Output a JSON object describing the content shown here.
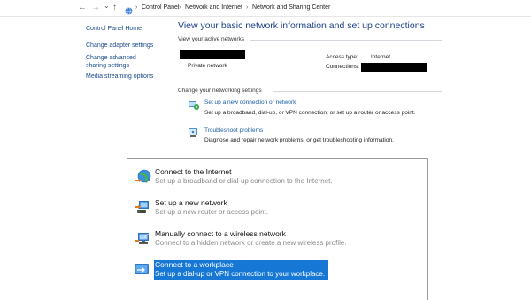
{
  "address": {
    "crumbs": [
      "Control Panel",
      "Network and Internet",
      "Network and Sharing Center"
    ],
    "sep": "›",
    "back": "←",
    "forward": "→",
    "dropdown": "⌄",
    "up": "↑"
  },
  "left_pane": {
    "home": "Control Panel Home",
    "links": [
      "Change adapter settings",
      "Change advanced sharing settings",
      "Media streaming options"
    ]
  },
  "main": {
    "title": "View your basic network information and set up connections",
    "active_header": "View your active networks",
    "network_type": "Private network",
    "access_type_label": "Access type:",
    "access_type_value": "Internet",
    "connections_label": "Connections:",
    "change_header": "Change your networking settings",
    "actions": [
      {
        "link": "Set up a new connection or network",
        "desc": "Set up a broadband, dial-up, or VPN connection; or set up a router or access point."
      },
      {
        "link": "Troubleshoot problems",
        "desc": "Diagnose and repair network problems, or get troubleshooting information."
      }
    ]
  },
  "wizard": {
    "options": [
      {
        "title": "Connect to the Internet",
        "desc": "Set up a broadband or dial-up connection to the Internet."
      },
      {
        "title": "Set up a new network",
        "desc": "Set up a new router or access point."
      },
      {
        "title": "Manually connect to a wireless network",
        "desc": "Connect to a hidden network or create a new wireless profile."
      },
      {
        "title": "Connect to a workplace",
        "desc": "Set up a dial-up or VPN connection to your workplace."
      }
    ],
    "selected_index": 3,
    "selection_color": "#1677d4"
  }
}
